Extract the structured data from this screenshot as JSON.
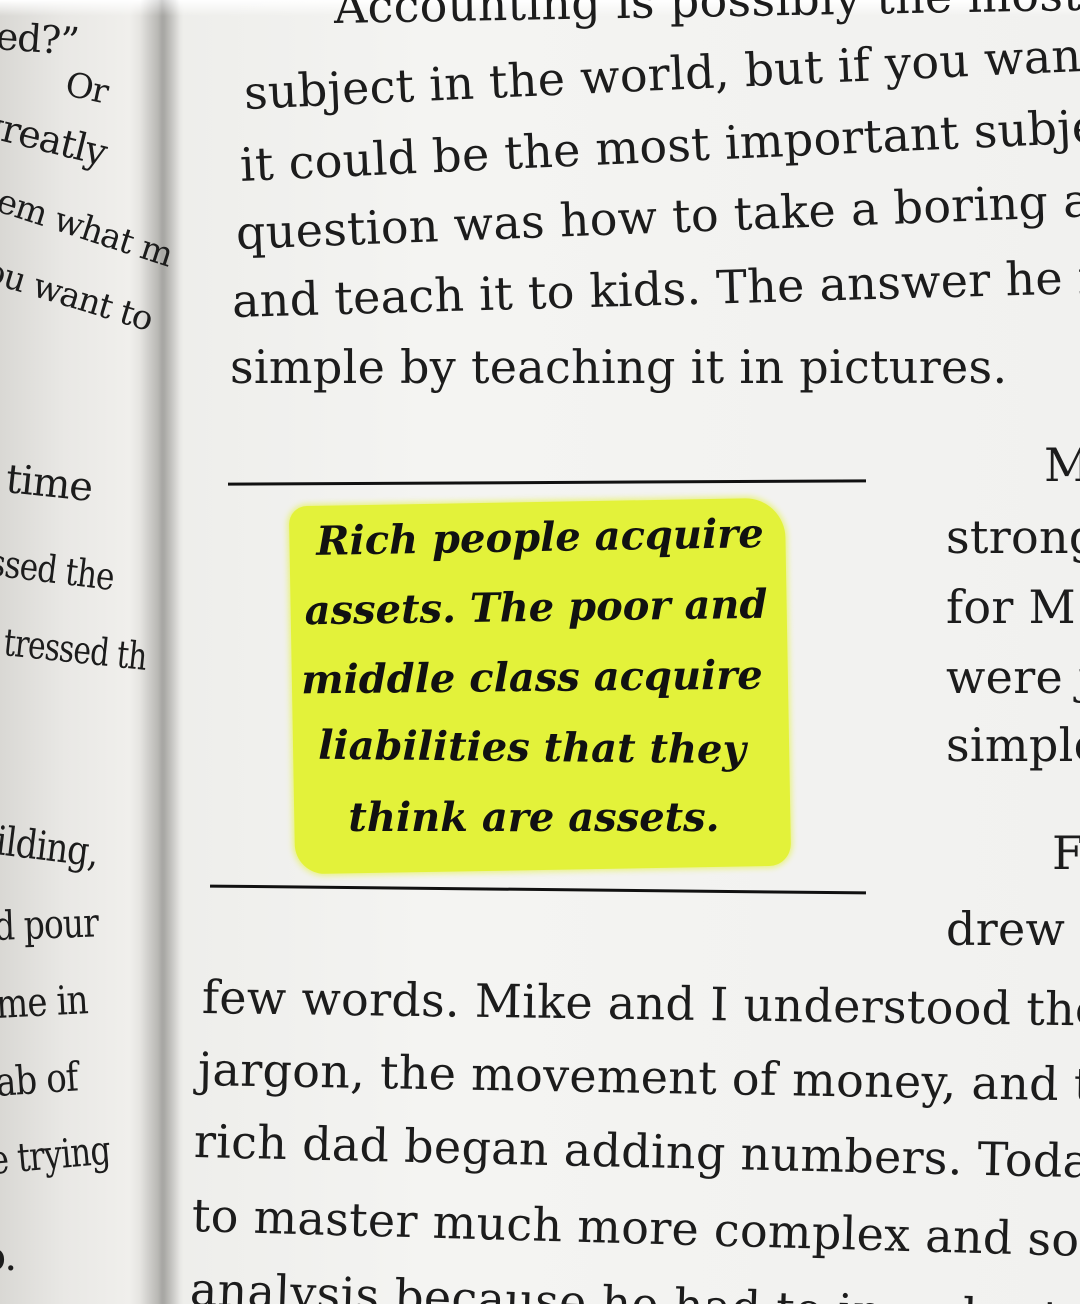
{
  "book_page": {
    "left_margin_fragments": [
      "ed?”",
      "Or",
      "greatly",
      "em what m",
      "ou want to",
      "time",
      "ssed the",
      "tressed th",
      "ilding,",
      "d pour",
      "me in",
      "ab of",
      "e trying",
      "o."
    ],
    "top_paragraph": [
      "Accounting is possibly the most co",
      "subject in the world, but if you want to",
      "it could be the most important subject.",
      "question was how to take a boring and",
      "and teach it to kids. The answer he fou",
      "simple by teaching it in pictures."
    ],
    "pull_quote": [
      "Rich people acquire",
      "assets. The poor and",
      "middle class acquire",
      "liabilities that they",
      "think are assets."
    ],
    "right_column_fragments": [
      "M",
      "strong",
      "for M",
      "were j",
      "simple",
      "F",
      "drew"
    ],
    "bottom_paragraph": [
      "few words. Mike and I understood the",
      "jargon, the movement of money, and t",
      "rich dad began adding numbers. Today",
      "to master much more complex and sop",
      "analysis because he had to in order to s"
    ],
    "highlight_color": "#e3f23a"
  }
}
